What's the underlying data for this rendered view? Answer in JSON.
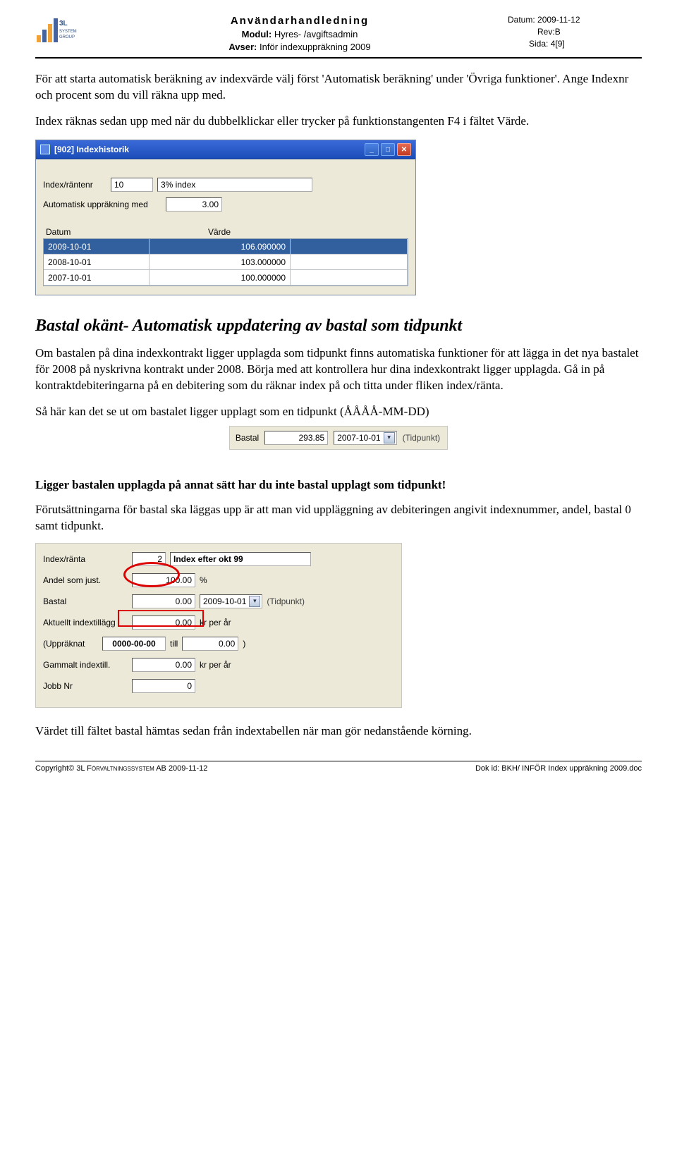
{
  "header": {
    "center": {
      "title": "Användarhandledning",
      "line2_label": "Modul:",
      "line2_value": "Hyres- /avgiftsadmin",
      "line3_label": "Avser:",
      "line3_value": "Inför indexuppräkning 2009"
    },
    "right": {
      "date_label": "Datum:",
      "date_value": "2009-11-12",
      "rev_label": "Rev:",
      "rev_value": "B",
      "page_label": "Sida:",
      "page_value": "4[9]"
    }
  },
  "body": {
    "p1": "För att starta automatisk beräkning av indexvärde välj först 'Automatisk beräkning' under 'Övriga funktioner'. Ange Indexnr och procent som du vill räkna upp med.",
    "p2": "Index räknas sedan upp med när du dubbelklickar eller trycker på funktionstangenten F4 i fältet Värde.",
    "heading1": "Bastal okänt- Automatisk uppdatering av bastal som tidpunkt",
    "p3": "Om bastalen på dina indexkontrakt ligger upplagda som tidpunkt finns automatiska funktioner för att lägga in det nya bastalet för 2008 på nyskrivna kontrakt under 2008. Börja med att kontrollera hur dina indexkontrakt ligger upplagda. Gå in på kontraktdebiteringarna på en debitering som du räknar index på och titta under fliken index/ränta.",
    "p4": "Så här kan det se ut om bastalet ligger upplagt som en tidpunkt (ÅÅÅÅ-MM-DD)",
    "bold_line": "Ligger bastalen upplagda på annat sätt har du inte bastal upplagt som tidpunkt!",
    "p5": "Förutsättningarna för bastal ska läggas upp är att man vid uppläggning av debiteringen angivit indexnummer, andel, bastal 0 samt tidpunkt.",
    "p6": "Värdet till fältet bastal hämtas sedan från indextabellen när man gör nedanstående körning."
  },
  "dialog1": {
    "title": "[902]  Indexhistorik",
    "fields": {
      "index_label": "Index/räntenr",
      "index_value": "10",
      "index_desc": "3% index",
      "autoup_label": "Automatisk uppräkning med",
      "autoup_value": "3.00"
    },
    "columns": {
      "c1": "Datum",
      "c2": "Värde"
    },
    "rows": [
      {
        "date": "2009-10-01",
        "value": "106.090000"
      },
      {
        "date": "2008-10-01",
        "value": "103.000000"
      },
      {
        "date": "2007-10-01",
        "value": "100.000000"
      }
    ]
  },
  "mini": {
    "label": "Bastal",
    "value": "293.85",
    "date": "2007-10-01",
    "suffix": "(Tidpunkt)"
  },
  "form2": {
    "r1": {
      "label": "Index/ränta",
      "val": "2",
      "desc": "Index efter okt 99"
    },
    "r2": {
      "label": "Andel som just.",
      "val": "100.00",
      "unit": "%"
    },
    "r3": {
      "label": "Bastal",
      "val": "0.00",
      "date": "2009-10-01",
      "suffix": "(Tidpunkt)"
    },
    "r4": {
      "label": "Aktuellt indextillägg",
      "val": "0.00",
      "unit": "kr per år"
    },
    "r5": {
      "label": "(Uppräknat",
      "d1": "0000-00-00",
      "mid": "till",
      "val": "0.00",
      "end": ")"
    },
    "r6": {
      "label": "Gammalt indextill.",
      "val": "0.00",
      "unit": "kr per år"
    },
    "r7": {
      "label": "Jobb Nr",
      "val": "0"
    }
  },
  "footer": {
    "left_a": "Copyright",
    "left_b": "3L Förvaltningssystem AB 2009-11-12",
    "right": "Dok id: BKH/ INFÖR Index uppräkning 2009.doc"
  }
}
